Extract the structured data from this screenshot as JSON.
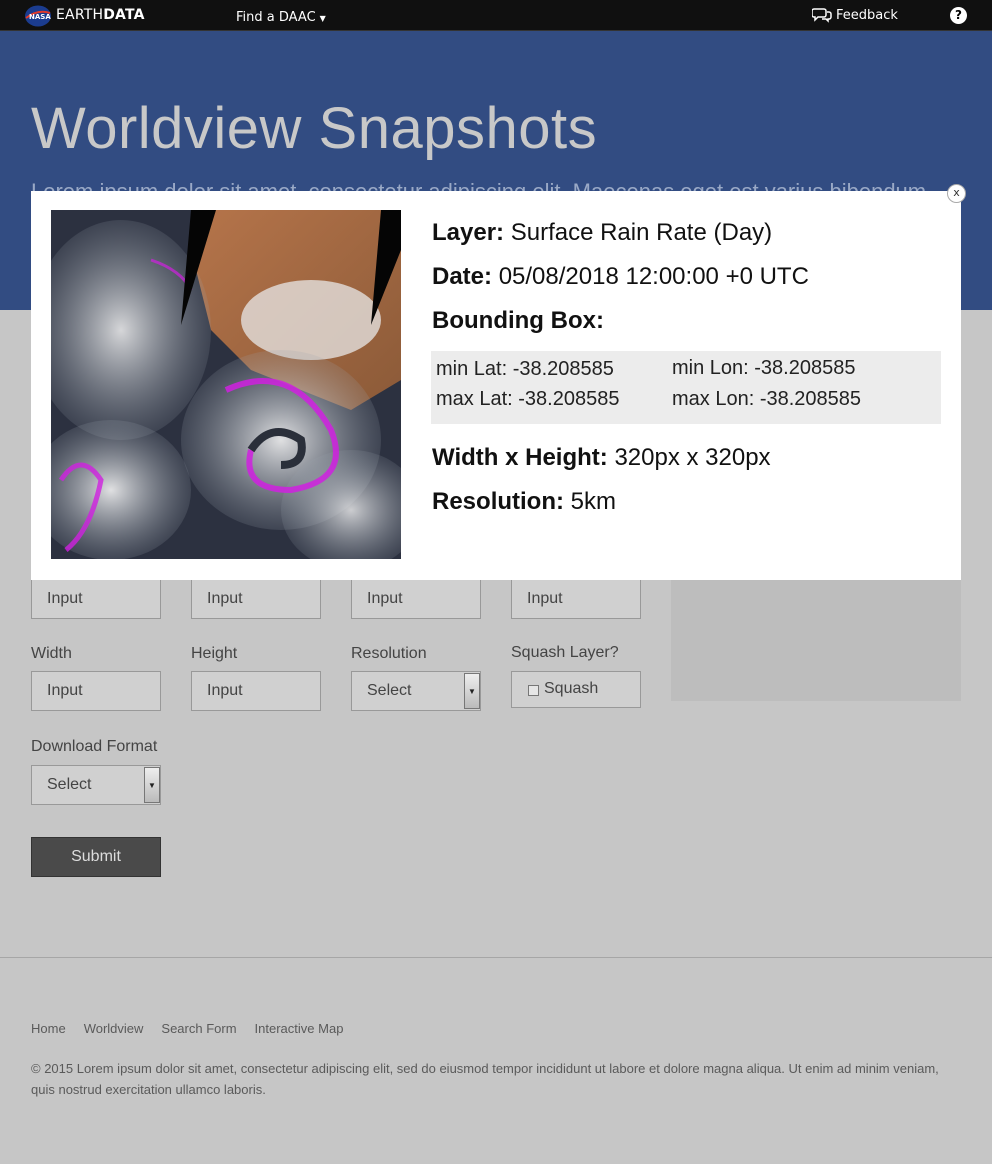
{
  "topbar": {
    "brand_part1": "EARTH",
    "brand_part2": "DATA",
    "find_daac": "Find a DAAC",
    "feedback": "Feedback",
    "help": "?"
  },
  "hero": {
    "title": "Worldview Snapshots",
    "subtitle": "Lorem ipsum dolor sit amet, consectetur adipiscing elit. Maecenas eget est varius bibendum"
  },
  "form": {
    "row1_inputs": [
      "Input",
      "Input",
      "Input",
      "Input"
    ],
    "width_label": "Width",
    "width_placeholder": "Input",
    "height_label": "Height",
    "height_placeholder": "Input",
    "resolution_label": "Resolution",
    "resolution_value": "Select",
    "squash_label": "Squash Layer?",
    "squash_checkbox_label": "Squash",
    "format_label": "Download Format",
    "format_value": "Select",
    "submit": "Submit"
  },
  "footer": {
    "links": [
      "Home",
      "Worldview",
      "Search Form",
      "Interactive Map"
    ],
    "copyright": "© 2015 Lorem ipsum dolor sit amet, consectetur adipiscing elit, sed do eiusmod tempor incididunt ut labore et dolore magna aliqua. Ut enim ad minim veniam, quis nostrud exercitation ullamco laboris."
  },
  "modal": {
    "close": "x",
    "layer_key": "Layer:",
    "layer_value": "Surface Rain Rate (Day)",
    "date_key": "Date:",
    "date_value": "05/08/2018 12:00:00 +0 UTC",
    "bbox_key": "Bounding Box:",
    "min_lat": "min Lat: -38.208585",
    "max_lat": "max Lat: -38.208585",
    "min_lon": "min Lon: -38.208585",
    "max_lon": "max Lon: -38.208585",
    "wh_key": "Width x Height:",
    "wh_value": "320px x 320px",
    "res_key": "Resolution:",
    "res_value": "5km"
  },
  "colors": {
    "hero_bg": "#324c82",
    "topbar_bg": "#101010",
    "rain_overlay": "#d020e0"
  }
}
